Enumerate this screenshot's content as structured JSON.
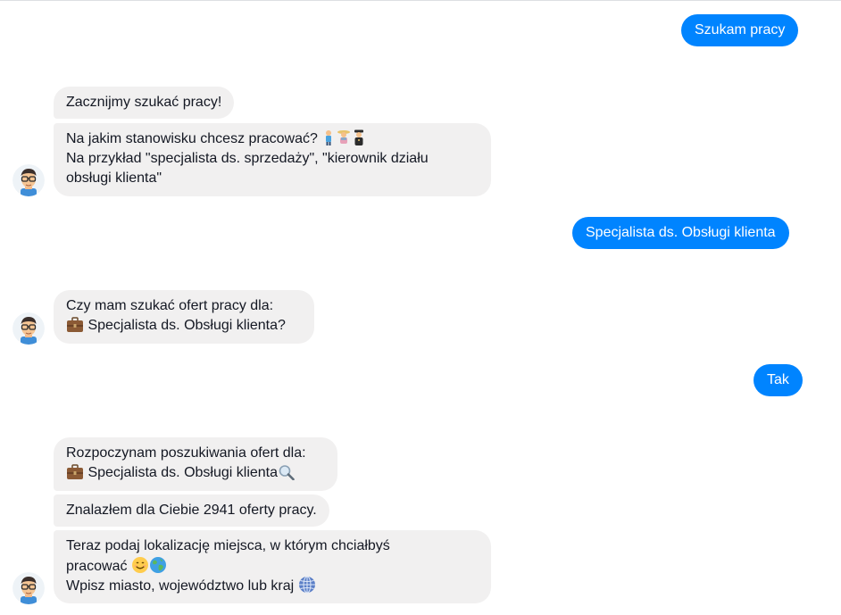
{
  "conversation": {
    "user_msg_1": "Szukam pracy",
    "bot_group_1": {
      "msg_1": "Zacznijmy szukać pracy!",
      "msg_2_line_1": "Na jakim stanowisku chcesz pracować?",
      "msg_2_line_2": "Na przykład \"specjalista ds. sprzedaży\", \"kierownik działu",
      "msg_2_line_3": "obsługi klienta\""
    },
    "user_msg_2": "Specjalista ds. Obsługi klienta",
    "bot_group_2": {
      "msg_1_line_1": "Czy mam szukać ofert pracy dla:",
      "msg_1_line_2": "Specjalista ds. Obsługi klienta?"
    },
    "user_msg_3": "Tak",
    "bot_group_3": {
      "msg_1_line_1": "Rozpoczynam poszukiwania ofert dla:",
      "msg_1_line_2": "Specjalista ds. Obsługi klienta",
      "msg_2": "Znalazłem dla Ciebie 2941 oferty pracy.",
      "msg_3_line_1": "Teraz podaj lokalizację miejsca, w którym chciałbyś",
      "msg_3_line_2": "pracować",
      "msg_3_line_3": "Wpisz miasto, województwo lub kraj"
    }
  },
  "icons": {
    "job_emojis": [
      "man-worker-icon",
      "woman-farmer-icon",
      "police-officer-icon"
    ],
    "briefcase": "briefcase-icon",
    "magnifier": "magnifying-glass-icon",
    "smile": "smiling-face-icon",
    "globe": "globe-earth-icon",
    "globe_meridians": "globe-meridians-icon",
    "avatar": "bot-avatar-icon"
  },
  "colors": {
    "user_bubble": "#0084ff",
    "bot_bubble": "#f1f0f0",
    "text": "#141823",
    "background": "#ffffff"
  }
}
